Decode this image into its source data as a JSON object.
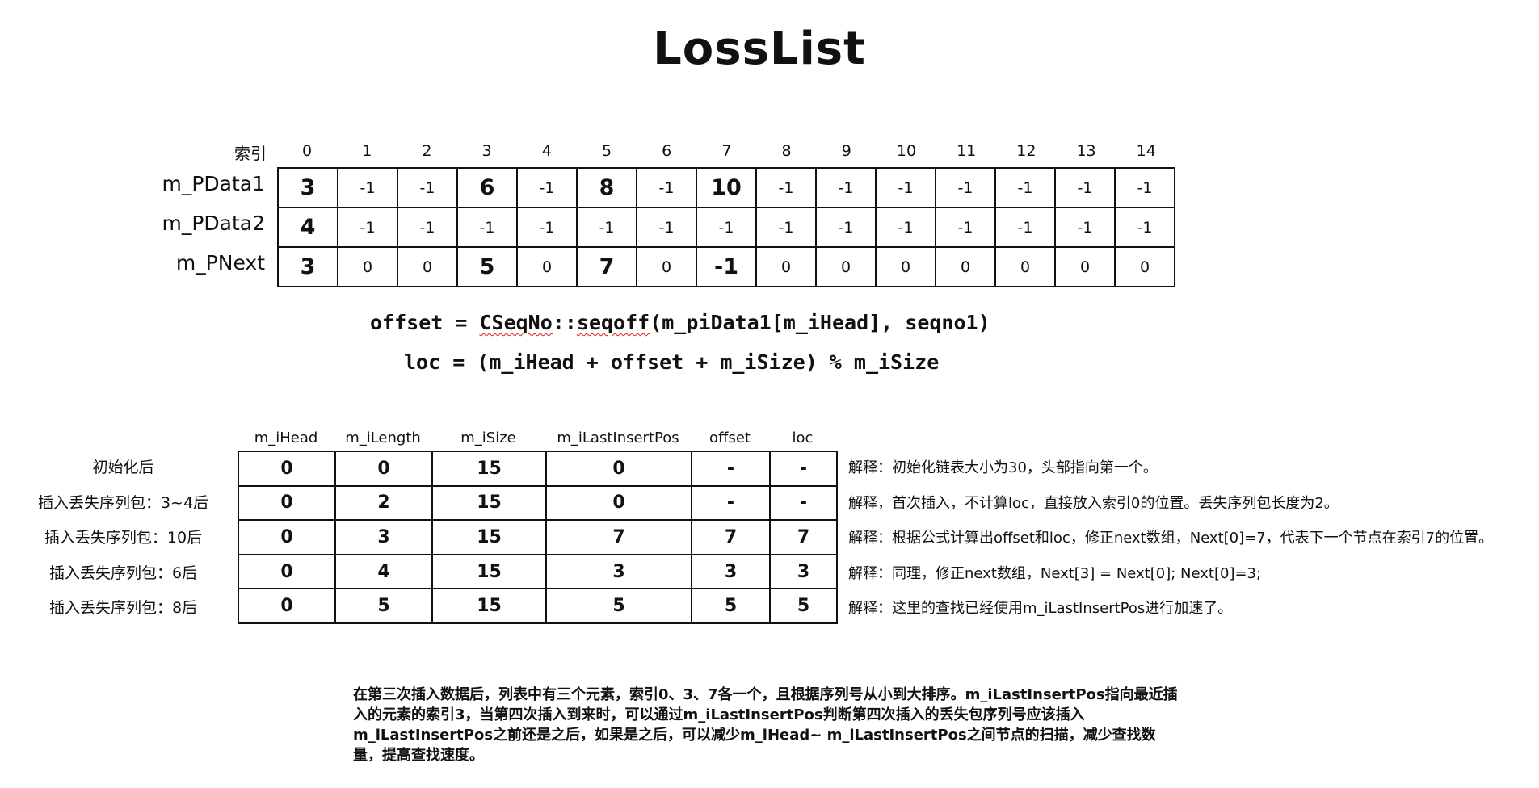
{
  "title": "LossList",
  "array_table": {
    "index_label": "索引",
    "indices": [
      "0",
      "1",
      "2",
      "3",
      "4",
      "5",
      "6",
      "7",
      "8",
      "9",
      "10",
      "11",
      "12",
      "13",
      "14"
    ],
    "rows": [
      {
        "label": "m_PData1",
        "values": [
          "3",
          "-1",
          "-1",
          "6",
          "-1",
          "8",
          "-1",
          "10",
          "-1",
          "-1",
          "-1",
          "-1",
          "-1",
          "-1",
          "-1"
        ],
        "bold": [
          0,
          3,
          5,
          7
        ]
      },
      {
        "label": "m_PData2",
        "values": [
          "4",
          "-1",
          "-1",
          "-1",
          "-1",
          "-1",
          "-1",
          "-1",
          "-1",
          "-1",
          "-1",
          "-1",
          "-1",
          "-1",
          "-1"
        ],
        "bold": [
          0
        ]
      },
      {
        "label": "m_PNext",
        "values": [
          "3",
          "0",
          "0",
          "5",
          "0",
          "7",
          "0",
          "-1",
          "0",
          "0",
          "0",
          "0",
          "0",
          "0",
          "0"
        ],
        "bold": [
          0,
          3,
          5,
          7
        ]
      }
    ]
  },
  "formulas": {
    "offset_prefix": "offset = ",
    "offset_class": "CSeqNo",
    "offset_sep": "::",
    "offset_func": "seqoff",
    "offset_rest": "(m_piData1[m_iHead], seqno1)",
    "loc": "loc = (m_iHead + offset + m_iSize) % m_iSize"
  },
  "state_table": {
    "headers": [
      "m_iHead",
      "m_iLength",
      "m_iSize",
      "m_iLastInsertPos",
      "offset",
      "loc"
    ],
    "rows": [
      {
        "label": "初始化后",
        "values": [
          "0",
          "0",
          "15",
          "0",
          "-",
          "-"
        ],
        "note": "解释：初始化链表大小为30，头部指向第一个。"
      },
      {
        "label": "插入丢失序列包：3~4后",
        "values": [
          "0",
          "2",
          "15",
          "0",
          "-",
          "-"
        ],
        "note": "解释，首次插入，不计算loc，直接放入索引0的位置。丢失序列包长度为2。"
      },
      {
        "label": "插入丢失序列包：10后",
        "values": [
          "0",
          "3",
          "15",
          "7",
          "7",
          "7"
        ],
        "note": "解释：根据公式计算出offset和loc，修正next数组，Next[0]=7，代表下一个节点在索引7的位置。"
      },
      {
        "label": "插入丢失序列包：6后",
        "values": [
          "0",
          "4",
          "15",
          "3",
          "3",
          "3"
        ],
        "note": "解释：同理，修正next数组，Next[3] = Next[0]; Next[0]=3;"
      },
      {
        "label": "插入丢失序列包：8后",
        "values": [
          "0",
          "5",
          "15",
          "5",
          "5",
          "5"
        ],
        "note": "解释：这里的查找已经使用m_iLastInsertPos进行加速了。"
      }
    ]
  },
  "paragraph": "在第三次插入数据后，列表中有三个元素，索引0、3、7各一个，且根据序列号从小到大排序。m_iLastInsertPos指向最近插入的元素的索引3，当第四次插入到来时，可以通过m_iLastInsertPos判断第四次插入的丢失包序列号应该插入m_iLastInsertPos之前还是之后，如果是之后，可以减少m_iHead~ m_iLastInsertPos之间节点的扫描，减少查找数量，提高查找速度。"
}
